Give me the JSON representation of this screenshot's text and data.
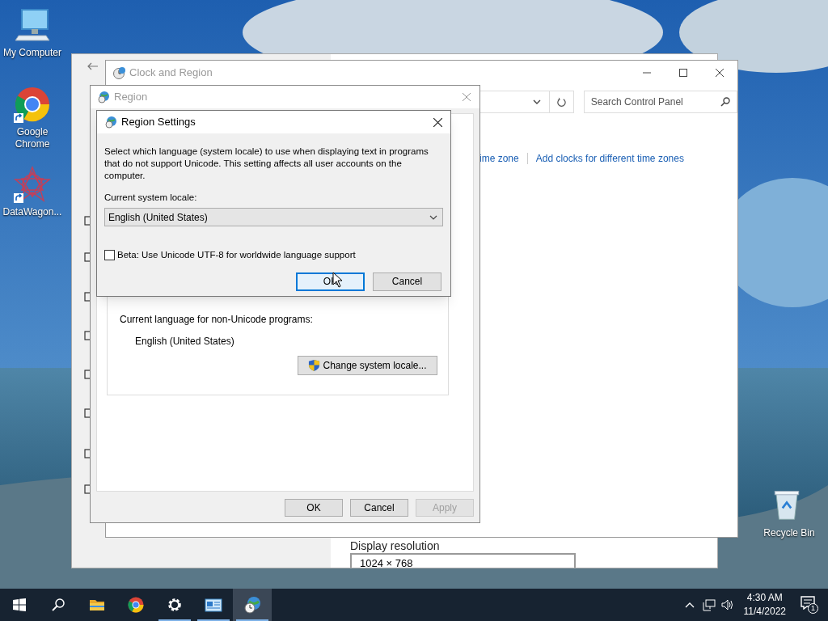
{
  "desktop_icons": [
    {
      "kind": "computer",
      "label": "My Computer",
      "shortcut": false
    },
    {
      "kind": "chrome",
      "label": "Google Chrome",
      "shortcut": true
    },
    {
      "kind": "star",
      "label": "DataWagon...",
      "shortcut": true
    },
    {
      "kind": "recycle",
      "label": "Recycle Bin",
      "shortcut": false
    }
  ],
  "settings_window": {
    "section_label": "Display resolution",
    "resolution": "1024 × 768"
  },
  "control_panel": {
    "title": "Clock and Region",
    "search_placeholder": "Search Control Panel",
    "links": [
      "ime zone",
      "Add clocks for different time zones"
    ]
  },
  "region_dialog": {
    "title": "Region",
    "language_label": "Current language for non-Unicode programs:",
    "language_value": "English (United States)",
    "change_button": "Change system locale...",
    "buttons": [
      {
        "label": "OK",
        "disabled": false
      },
      {
        "label": "Cancel",
        "disabled": false
      },
      {
        "label": "Apply",
        "disabled": true
      }
    ]
  },
  "region_settings": {
    "title": "Region Settings",
    "description": "Select which language (system locale) to use when displaying text in programs that do not support Unicode. This setting affects all user accounts on the computer.",
    "locale_label": "Current system locale:",
    "locale_value": "English (United States)",
    "beta_checkbox": {
      "label": "Beta: Use Unicode UTF-8 for worldwide language support",
      "checked": false
    },
    "buttons": [
      {
        "label": "OK",
        "focused": true
      },
      {
        "label": "Cancel",
        "focused": false
      }
    ]
  },
  "taskbar": {
    "apps": [
      {
        "kind": "start",
        "running": false,
        "selected": false
      },
      {
        "kind": "search",
        "running": false,
        "selected": false
      },
      {
        "kind": "explorer",
        "running": false,
        "selected": false
      },
      {
        "kind": "chrome",
        "running": false,
        "selected": false
      },
      {
        "kind": "settings",
        "running": true,
        "selected": false
      },
      {
        "kind": "control",
        "running": true,
        "selected": false
      },
      {
        "kind": "region",
        "running": true,
        "selected": true
      }
    ],
    "time": "4:30 AM",
    "date": "11/4/2022",
    "notification_count": "1"
  }
}
